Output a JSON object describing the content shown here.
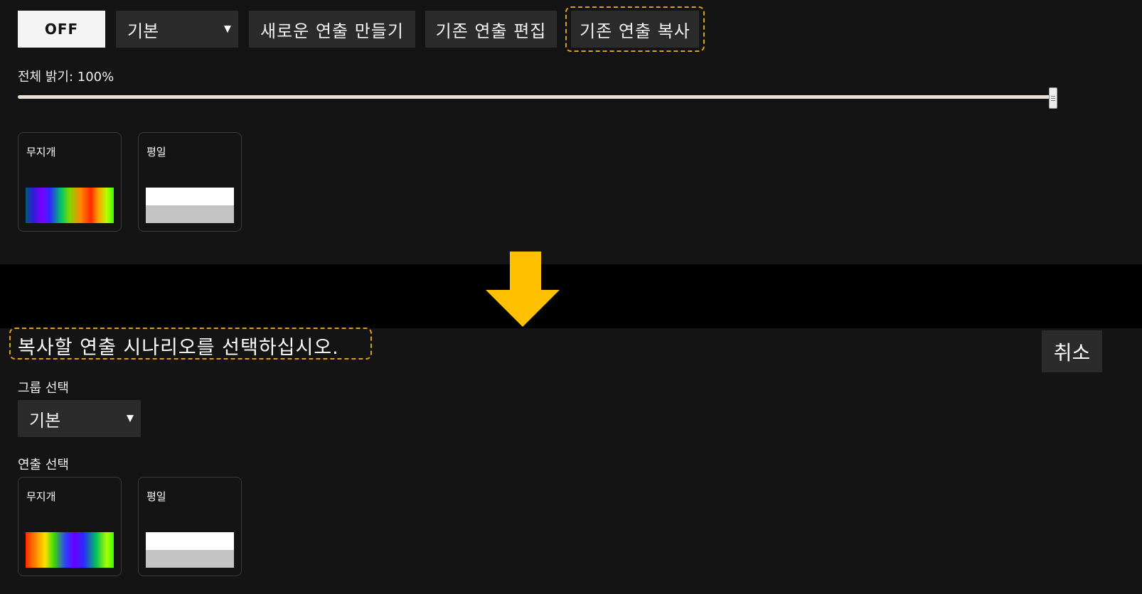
{
  "top": {
    "toolbar": {
      "power_label": "OFF",
      "group_select_value": "기본",
      "new_label": "새로운 연출 만들기",
      "edit_label": "기존 연출 편집",
      "copy_label": "기존 연출 복사"
    },
    "brightness": {
      "label": "전체 밝기: 100%",
      "value_percent": 100
    },
    "presets": [
      {
        "name": "무지개",
        "swatch": "rainbow"
      },
      {
        "name": "평일",
        "swatch": "plain"
      }
    ]
  },
  "arrow": {
    "icon": "down-arrow-icon",
    "color": "#ffc000"
  },
  "bottom": {
    "prompt": "복사할 연출 시나리오를 선택하십시오.",
    "cancel_label": "취소",
    "group": {
      "label": "그룹 선택",
      "value": "기본"
    },
    "scene": {
      "label": "연출 선택"
    },
    "presets": [
      {
        "name": "무지개",
        "swatch": "rainbow"
      },
      {
        "name": "평일",
        "swatch": "plain"
      }
    ]
  },
  "colors": {
    "highlight": "#d9a11b",
    "panel": "#141414",
    "button": "#2b2b2b"
  }
}
